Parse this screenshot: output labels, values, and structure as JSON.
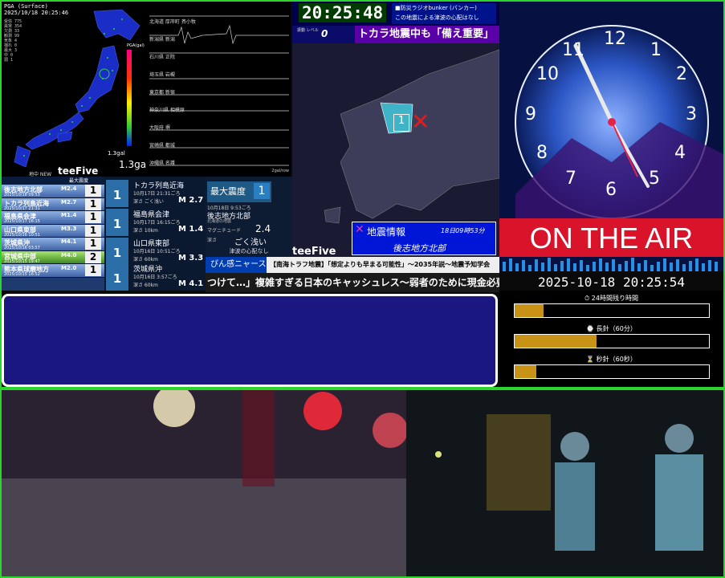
{
  "map": {
    "header": "PGA (Surface)",
    "datetime": "2025/10/18 20:25:46",
    "stats": [
      "受信 775",
      "異常 354",
      "欠測 33",
      "観測 99",
      "気象 4",
      "揺れ 0",
      "最大 3",
      "中 0",
      "弱 1"
    ],
    "pga_label": "PGA(gal)",
    "gal_small": "1.3gal",
    "gal_value": "1.3gal",
    "sub_label": "地中 NEW",
    "brand": "teeFive"
  },
  "waves": {
    "rows": [
      "北海道 厚岸町 斉小牧",
      "新潟県 新潟",
      "石川県 正院",
      "埼玉県 岩槻",
      "東京都 新宿",
      "神奈川県 相模原",
      "大阪府 堺",
      "宮崎県 都城",
      "沖縄県 名護"
    ],
    "scale_label": "2gal/row"
  },
  "clock": {
    "time": "20:25:48",
    "bunker_title": "■防災ラジオbunker (バンカー)",
    "bunker_text": "この地震による津波の心配はなし"
  },
  "seismap": {
    "level_label": "振動\nレベル",
    "level_value": "0",
    "banner": "トカラ地震中も「備え重要」",
    "marker_intensity": "1",
    "eq_title": "地震情報",
    "eq_time": "18日09時53分",
    "eq_place": "後志地方北部",
    "brand": "teeFive"
  },
  "space": {
    "on_air": "ON THE AIR",
    "datetime": "2025-10-18 20:25:54",
    "clock_numbers": [
      "12",
      "1",
      "2",
      "3",
      "4",
      "5",
      "6",
      "7",
      "8",
      "9",
      "10",
      "11"
    ]
  },
  "list": {
    "header": "最大震度",
    "rows": [
      {
        "name": "後志地方北部",
        "date": "2025/10/18 09:53",
        "mag": "M2.4",
        "intensity": "1"
      },
      {
        "name": "トカラ列島近海",
        "date": "2025/10/17 21:31",
        "mag": "M2.7",
        "intensity": "1"
      },
      {
        "name": "福島県会津",
        "date": "2025/10/17 16:15",
        "mag": "M1.4",
        "intensity": "1"
      },
      {
        "name": "山口県東部",
        "date": "2025/10/16 10:51",
        "mag": "M3.3",
        "intensity": "1"
      },
      {
        "name": "茨城県沖",
        "date": "2025/10/16 03:57",
        "mag": "M4.1",
        "intensity": "1"
      },
      {
        "name": "宮城県中部",
        "date": "2025/10/15 19:47",
        "mag": "M4.0",
        "intensity": "2"
      },
      {
        "name": "熊本県球磨地方",
        "date": "2025/10/15 16:52",
        "mag": "M2.0",
        "intensity": "1"
      }
    ]
  },
  "mid": {
    "cards": [
      {
        "place": "トカラ列島近海",
        "date": "10月17日 21:31ごろ",
        "meta": "深さ ごく浅い",
        "mag": "M 2.7",
        "intensity": "1"
      },
      {
        "place": "福島県会津",
        "date": "10月17日 16:15ごろ",
        "meta": "深さ 10km",
        "mag": "M 1.4",
        "intensity": "1"
      },
      {
        "place": "山口県東部",
        "date": "10月16日 10:51ごろ",
        "meta": "深さ 60km",
        "mag": "M 3.3",
        "intensity": "1"
      },
      {
        "place": "茨城県沖",
        "date": "10月16日 3:57ごろ",
        "meta": "深さ 60km",
        "mag": "M 4.1",
        "intensity": "1"
      }
    ]
  },
  "detail": {
    "max_label": "最大震度",
    "max_value": "1",
    "time": "10月18日 9:53ごろ",
    "place": "後志地方北部",
    "sub": "北海道の地震",
    "mag_label": "マグニチュード",
    "mag_value": "2.4",
    "depth_label": "深さ",
    "depth_value": "ごく浅い",
    "tsunami": "津波の心配なし"
  },
  "news": {
    "tag": "ぴん感ニャース",
    "headline": "【南海トラフ地震】「想定よりも早まる可能性」〜2035年説〜地震予知学会",
    "ticker": "つけて…」複雑すぎる日本のキャッシュレス〜弱者のために現金必要"
  },
  "bars": {
    "items": [
      {
        "label": "⏱ 24時間残り時間",
        "progress": 0.15
      },
      {
        "label": "⌚ 長針（60分）",
        "progress": 0.42
      },
      {
        "label": "⏳ 秒針（60秒）",
        "progress": 0.11
      }
    ]
  },
  "colors": {
    "border": "#2bd52b",
    "news_tag": "#003db1",
    "eq_panel": "#0016d6",
    "on_air": "#d8132a"
  }
}
